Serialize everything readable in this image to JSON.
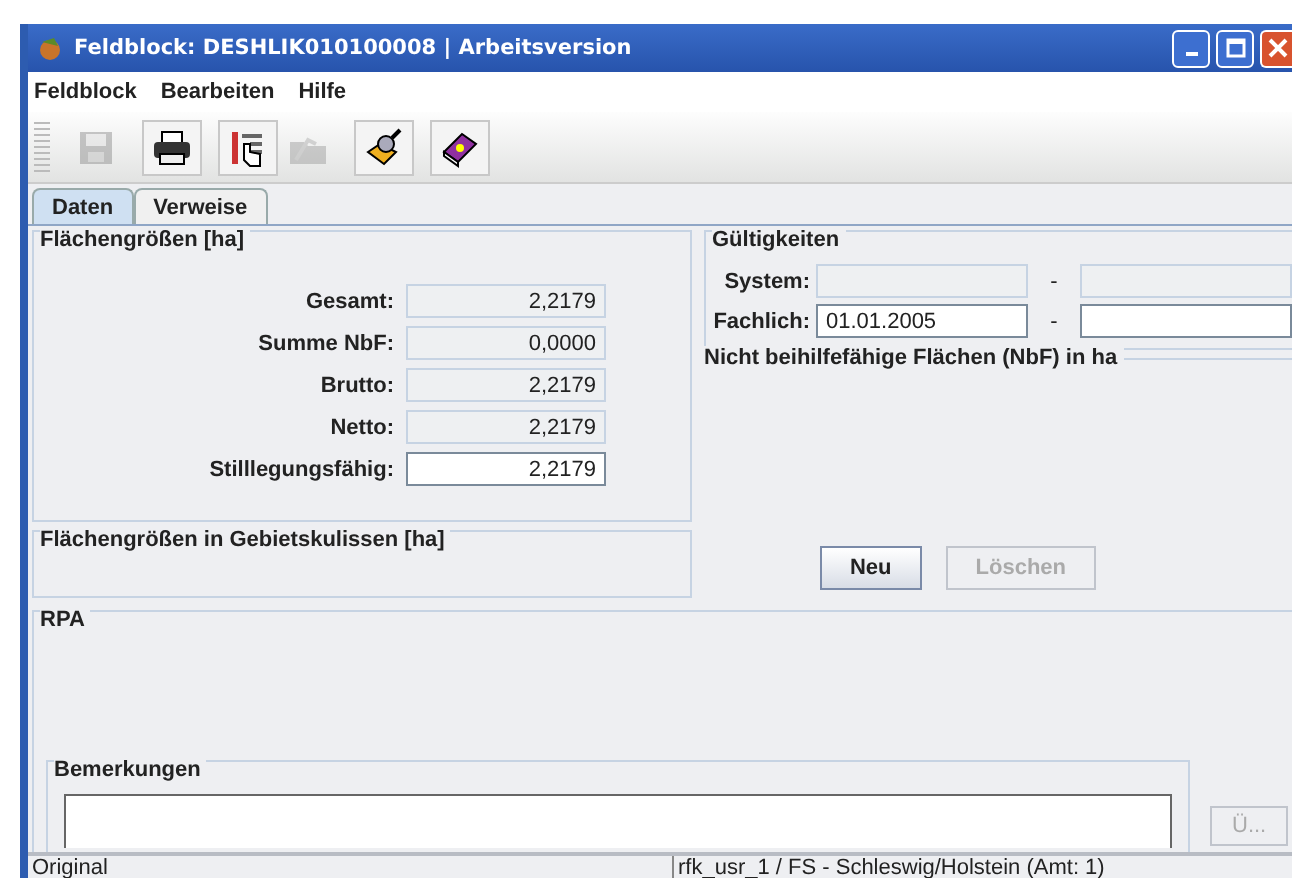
{
  "window": {
    "title": "Feldblock: DESHLIK010100008 | Arbeitsversion"
  },
  "menu": [
    {
      "label": "Feldblock"
    },
    {
      "label": "Bearbeiten"
    },
    {
      "label": "Hilfe"
    }
  ],
  "toolbar": [
    {
      "kind": "save",
      "disabled": true
    },
    {
      "kind": "print",
      "disabled": false
    },
    {
      "kind": "pointer",
      "disabled": false
    },
    {
      "kind": "folder",
      "disabled": true
    },
    {
      "kind": "magnifier",
      "disabled": false
    },
    {
      "kind": "book",
      "disabled": false
    }
  ],
  "tabs": [
    {
      "label": "Daten",
      "selected": true
    },
    {
      "label": "Verweise",
      "selected": false
    }
  ],
  "areas": {
    "title": "Flächengrößen [ha]",
    "fields": [
      {
        "label": "Gesamt:",
        "value": "2,2179",
        "editable": false
      },
      {
        "label": "Summe NbF:",
        "value": "0,0000",
        "editable": false
      },
      {
        "label": "Brutto:",
        "value": "2,2179",
        "editable": false
      },
      {
        "label": "Netto:",
        "value": "2,2179",
        "editable": false
      },
      {
        "label": "Stilllegungsfähig:",
        "value": "2,2179",
        "editable": true
      }
    ]
  },
  "zones": {
    "title": "Flächengrößen in Gebietskulissen [ha]"
  },
  "validity": {
    "title": "Gültigkeiten",
    "rows": [
      {
        "label": "System:",
        "editable": false,
        "separator": "-"
      },
      {
        "label": "Fachlich:",
        "from": "01.01.2005",
        "editable": true,
        "separator": "-"
      }
    ]
  },
  "nbf": {
    "title": "Nicht beihilfefähige Flächen (NbF) in ha",
    "buttons": [
      {
        "label": "Neu",
        "disabled": false
      },
      {
        "label": "Löschen",
        "disabled": true
      }
    ]
  },
  "rpa": {
    "title": "RPA",
    "remarks": {
      "title": "Bemerkungen"
    },
    "button": {
      "label": "Ü...",
      "disabled": true
    }
  },
  "status_bar": [
    "Original",
    "rfk_usr_1 / FS - Schleswig/Holstein (Amt: 1)"
  ]
}
